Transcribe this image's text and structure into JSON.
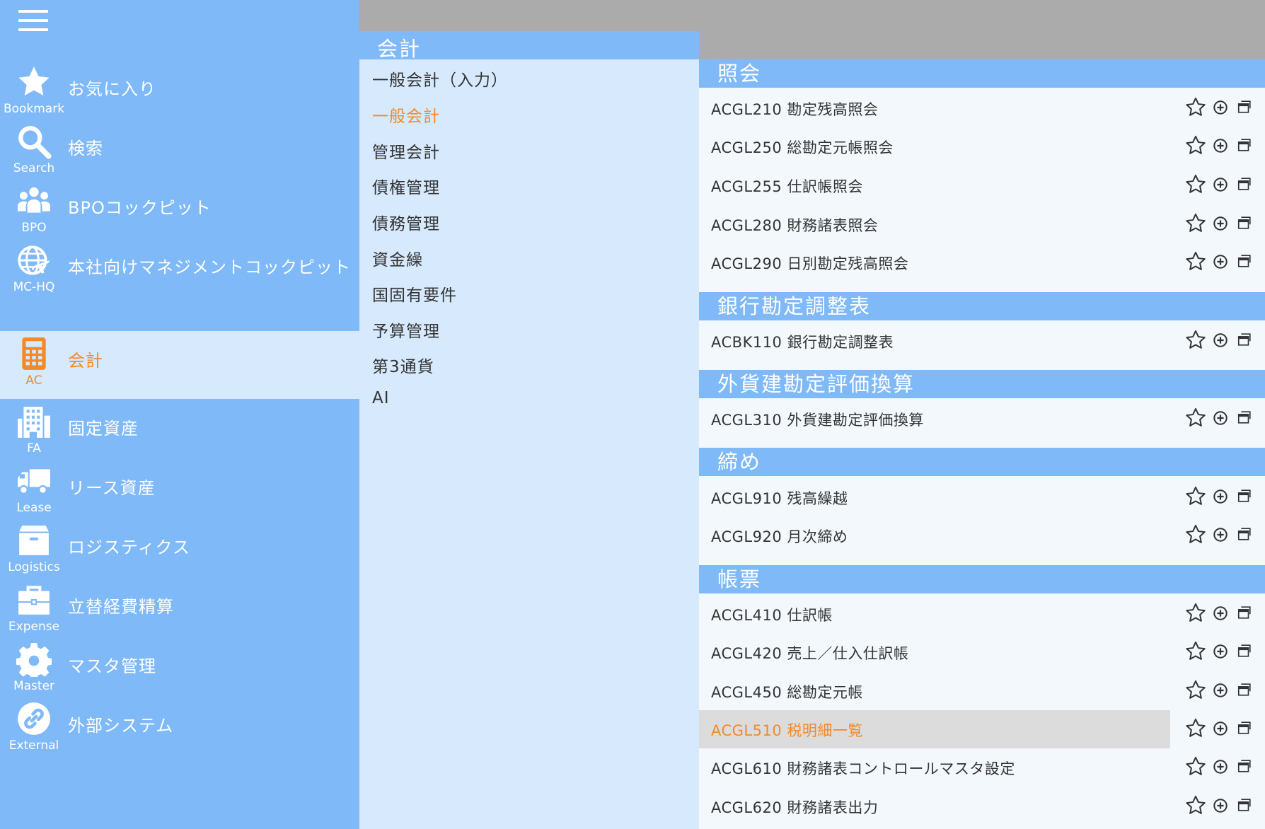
{
  "sidebar": {
    "items": [
      {
        "code": "Bookmark",
        "label": "お気に入り",
        "icon": "star-icon",
        "active": false
      },
      {
        "code": "Search",
        "label": "検索",
        "icon": "search-icon",
        "active": false
      },
      {
        "code": "BPO",
        "label": "BPOコックピット",
        "icon": "people-icon",
        "active": false
      },
      {
        "code": "MC-HQ",
        "label": "本社向けマネジメントコックピット",
        "icon": "globe-plane-icon",
        "active": false
      },
      {
        "code": "AC",
        "label": "会計",
        "icon": "calculator-icon",
        "active": true
      },
      {
        "code": "FA",
        "label": "固定資産",
        "icon": "building-icon",
        "active": false
      },
      {
        "code": "Lease",
        "label": "リース資産",
        "icon": "truck-icon",
        "active": false
      },
      {
        "code": "Logistics",
        "label": "ロジスティクス",
        "icon": "box-icon",
        "active": false
      },
      {
        "code": "Expense",
        "label": "立替経費精算",
        "icon": "briefcase-icon",
        "active": false
      },
      {
        "code": "Master",
        "label": "マスタ管理",
        "icon": "gear-icon",
        "active": false
      },
      {
        "code": "External",
        "label": "外部システム",
        "icon": "link-icon",
        "active": false
      }
    ]
  },
  "middle": {
    "header": "会計",
    "items": [
      {
        "label": "一般会計（入力）",
        "active": false
      },
      {
        "label": "一般会計",
        "active": true
      },
      {
        "label": "管理会計",
        "active": false
      },
      {
        "label": "債権管理",
        "active": false
      },
      {
        "label": "債務管理",
        "active": false
      },
      {
        "label": "資金繰",
        "active": false
      },
      {
        "label": "国固有要件",
        "active": false
      },
      {
        "label": "予算管理",
        "active": false
      },
      {
        "label": "第3通貨",
        "active": false
      },
      {
        "label": "AI",
        "active": false
      }
    ]
  },
  "right": {
    "sections": [
      {
        "title": "照会",
        "rows": [
          {
            "text": "ACGL210 勘定残高照会",
            "highlighted": false
          },
          {
            "text": "ACGL250 総勘定元帳照会",
            "highlighted": false
          },
          {
            "text": "ACGL255 仕訳帳照会",
            "highlighted": false
          },
          {
            "text": "ACGL280 財務諸表照会",
            "highlighted": false
          },
          {
            "text": "ACGL290 日別勘定残高照会",
            "highlighted": false
          }
        ]
      },
      {
        "title": "銀行勘定調整表",
        "rows": [
          {
            "text": "ACBK110 銀行勘定調整表",
            "highlighted": false
          }
        ]
      },
      {
        "title": "外貨建勘定評価換算",
        "rows": [
          {
            "text": "ACGL310 外貨建勘定評価換算",
            "highlighted": false
          }
        ]
      },
      {
        "title": "締め",
        "rows": [
          {
            "text": "ACGL910 残高繰越",
            "highlighted": false
          },
          {
            "text": "ACGL920 月次締め",
            "highlighted": false
          }
        ]
      },
      {
        "title": "帳票",
        "rows": [
          {
            "text": "ACGL410 仕訳帳",
            "highlighted": false
          },
          {
            "text": "ACGL420 売上／仕入仕訳帳",
            "highlighted": false
          },
          {
            "text": "ACGL450 総勘定元帳",
            "highlighted": false
          },
          {
            "text": "ACGL510 税明細一覧",
            "highlighted": true
          },
          {
            "text": "ACGL610 財務諸表コントロールマスタ設定",
            "highlighted": false
          },
          {
            "text": "ACGL620 財務諸表出力",
            "highlighted": false
          }
        ]
      }
    ],
    "row_icons": [
      "star-outline-icon",
      "plus-circle-icon",
      "new-window-icon"
    ]
  },
  "colors": {
    "sidebar_bg": "#7fb9f8",
    "active_bg": "#d6e9fd",
    "accent": "#f28a2a",
    "topbar_gray": "#ababab",
    "row_highlight": "#dcdcdc",
    "panel_bg": "#f3f8fd"
  }
}
